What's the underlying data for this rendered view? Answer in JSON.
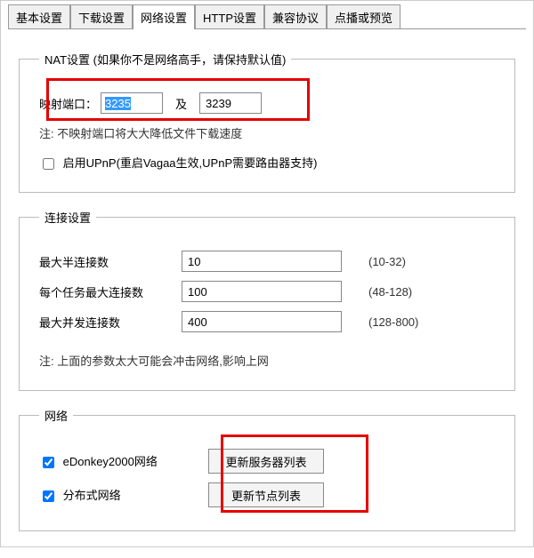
{
  "tabs": {
    "t0": "基本设置",
    "t1": "下载设置",
    "t2": "网络设置",
    "t3": "HTTP设置",
    "t4": "兼容协议",
    "t5": "点播或预览"
  },
  "nat": {
    "legend": "NAT设置  (如果你不是网络高手，请保持默认值)",
    "port_label": "映射端口：",
    "port1": "3235",
    "and": "及",
    "port2": "3239",
    "note": "注: 不映射端口将大大降低文件下载速度",
    "upnp": "启用UPnP(重启Vagaa生效,UPnP需要路由器支持)"
  },
  "conn": {
    "legend": "连接设置",
    "half_label": "最大半连接数",
    "half_val": "10",
    "half_range": "(10-32)",
    "pertask_label": "每个任务最大连接数",
    "pertask_val": "100",
    "pertask_range": "(48-128)",
    "concurrent_label": "最大并发连接数",
    "concurrent_val": "400",
    "concurrent_range": "(128-800)",
    "note": "注: 上面的参数太大可能会冲击网络,影响上网"
  },
  "net": {
    "legend": "网络",
    "edonkey": "eDonkey2000网络",
    "btn_server": "更新服务器列表",
    "kad": "分布式网络",
    "btn_nodes": "更新节点列表"
  }
}
